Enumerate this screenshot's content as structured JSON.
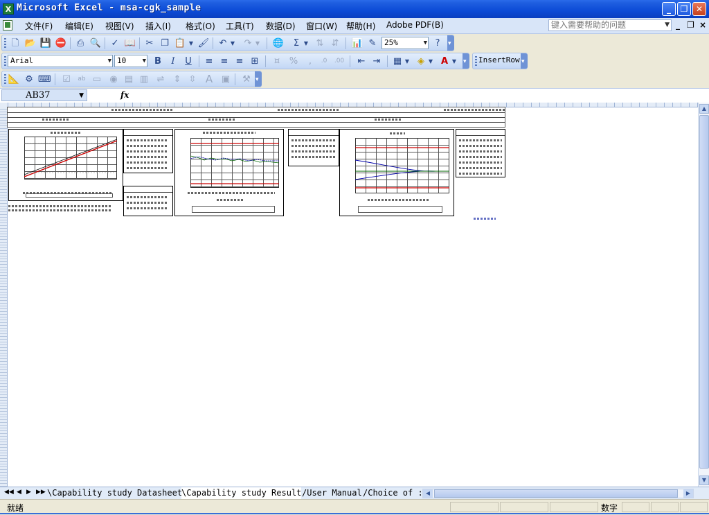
{
  "window": {
    "title": "Microsoft Excel - msa-cgk_sample",
    "app_icon": "X",
    "buttons": {
      "minimize": "_",
      "restore": "❐",
      "close": "✕"
    }
  },
  "menu": {
    "items": [
      "文件(F)",
      "编辑(E)",
      "视图(V)",
      "插入(I)",
      "格式(O)",
      "工具(T)",
      "数据(D)",
      "窗口(W)",
      "帮助(H)",
      "Adobe PDF(B)"
    ],
    "help_placeholder": "键入需要帮助的问题",
    "doc_controls": {
      "minimize": "_",
      "restore": "❐",
      "close": "×"
    }
  },
  "toolbar_standard": {
    "zoom": "25%"
  },
  "toolbar_format": {
    "font": "Arial",
    "size": "10",
    "insert_row": "InsertRow"
  },
  "formula_bar": {
    "name_box": "AB37",
    "fx": "fx",
    "formula": ""
  },
  "sheet_tabs": {
    "nav": [
      "◀◀",
      "◀",
      "▶",
      "▶▶"
    ],
    "tabs": [
      "Capability study Datasheet",
      "Capability study Result",
      "User Manual",
      "Choice of :"
    ],
    "active_index": 1
  },
  "status": {
    "ready": "就绪",
    "mode": "数字"
  },
  "colors": {
    "title_bar": "#0c4bd6",
    "menu_bar": "#d8e5f8",
    "toolbar": "#c3d7f5",
    "grid_header": "#e4ecf7"
  },
  "icons": {
    "standard": [
      "new-icon",
      "open-icon",
      "save-icon",
      "permission-icon",
      "print-icon",
      "print-preview-icon",
      "spelling-icon",
      "research-icon",
      "cut-icon",
      "copy-icon",
      "paste-icon",
      "format-painter-icon",
      "undo-icon",
      "redo-icon",
      "hyperlink-icon",
      "autosum-icon",
      "sort-asc-icon",
      "sort-desc-icon",
      "chart-wizard-icon",
      "drawing-icon",
      "help-icon"
    ],
    "format": [
      "bold-icon",
      "italic-icon",
      "underline-icon",
      "align-left-icon",
      "align-center-icon",
      "align-right-icon",
      "merge-center-icon",
      "currency-icon",
      "percent-icon",
      "comma-icon",
      "increase-decimal-icon",
      "decrease-decimal-icon",
      "decrease-indent-icon",
      "increase-indent-icon",
      "borders-icon",
      "fill-color-icon",
      "font-color-icon"
    ],
    "forms": [
      "design-mode-icon",
      "properties-icon",
      "view-code-icon",
      "checkbox-icon",
      "textbox-icon",
      "button-icon",
      "option-icon",
      "listbox-icon",
      "combobox-icon",
      "toggle-icon",
      "spin-icon",
      "scrollbar-icon",
      "label-icon",
      "image-icon",
      "more-controls-icon"
    ]
  }
}
